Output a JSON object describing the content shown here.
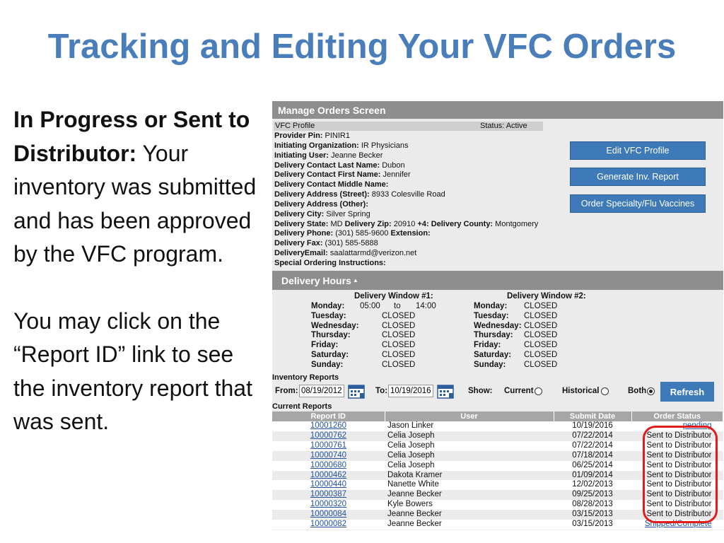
{
  "slide": {
    "title": "Tracking and Editing Your VFC Orders",
    "para1_bold": "In Progress or Sent to Distributor:",
    "para1_rest": " Your inventory was submitted and has been approved by the VFC program.",
    "para2": "You may click on the “Report ID” link to see the inventory report that was sent.",
    "highlight_color": "#e41b1b"
  },
  "screen": {
    "title": "Manage Orders Screen",
    "profile_label": "VFC Profile",
    "status_label": "Status: Active",
    "fields": [
      {
        "label": "Provider Pin:",
        "value": " PINIR1"
      },
      {
        "label": "Initiating Organization:",
        "value": " IR Physicians"
      },
      {
        "label": "Initiating User:",
        "value": " Jeanne Becker"
      },
      {
        "label": "Delivery Contact Last Name:",
        "value": " Dubon"
      },
      {
        "label": "Delivery Contact First Name:",
        "value": " Jennifer"
      },
      {
        "label": "Delivery Contact Middle Name:",
        "value": ""
      },
      {
        "label": "Delivery Address (Street):",
        "value": " 8933 Colesville Road"
      },
      {
        "label": "Delivery Address (Other):",
        "value": ""
      },
      {
        "label": "Delivery City:",
        "value": " Silver Spring"
      },
      {
        "label": "Delivery State:",
        "value": " MD ",
        "label2": "Delivery Zip:",
        "value2": " 20910 ",
        "label3": "+4:",
        "value3": " ",
        "label4": "Delivery County:",
        "value4": " Montgomery"
      },
      {
        "label": "Delivery Phone:",
        "value": " (301) 585-9600 ",
        "label2": "Extension:",
        "value2": ""
      },
      {
        "label": "Delivery Fax:",
        "value": " (301) 585-5888"
      },
      {
        "label": "DeliveryEmail:",
        "value": " saalattarmd@verizon.net"
      },
      {
        "label": "Special Ordering Instructions:",
        "value": ""
      }
    ],
    "buttons": {
      "edit_profile": "Edit VFC Profile",
      "generate_report": "Generate Inv. Report",
      "order_specialty": "Order Specialty/Flu Vaccines"
    },
    "delivery_hours": {
      "title": "Delivery Hours",
      "window1_title": "Delivery Window #1:",
      "window2_title": "Delivery Window #2:",
      "days": [
        "Monday:",
        "Tuesday:",
        "Wednesday:",
        "Thursday:",
        "Friday:",
        "Saturday:",
        "Sunday:"
      ],
      "monday_from": "05:00",
      "monday_to_word": "to",
      "monday_to": "14:00",
      "window1_closed": [
        "CLOSED",
        "CLOSED",
        "CLOSED",
        "CLOSED",
        "CLOSED",
        "CLOSED"
      ],
      "window2": [
        "CLOSED",
        "CLOSED",
        "CLOSED",
        "CLOSED",
        "CLOSED",
        "CLOSED",
        "CLOSED"
      ]
    },
    "inventory": {
      "label": "Inventory Reports",
      "from_label": "From:",
      "from_value": "08/19/2012",
      "to_label": "To:",
      "to_value": "10/19/2016",
      "show_label": "Show:",
      "current_label": "Current",
      "historical_label": "Historical",
      "both_label": "Both",
      "selected": "Both",
      "refresh_label": "Refresh"
    },
    "current_reports_label": "Current Reports",
    "table": {
      "headers": [
        "Report ID",
        "User",
        "Submit Date",
        "Order Status"
      ],
      "rows": [
        {
          "id": "10001260",
          "user": "Jason Linker",
          "date": "10/19/2016",
          "status": "pending",
          "status_link": true
        },
        {
          "id": "10000762",
          "user": "Celia Joseph",
          "date": "07/22/2014",
          "status": "Sent to Distributor",
          "status_link": false
        },
        {
          "id": "10000761",
          "user": "Celia Joseph",
          "date": "07/22/2014",
          "status": "Sent to Distributor",
          "status_link": false
        },
        {
          "id": "10000740",
          "user": "Celia Joseph",
          "date": "07/18/2014",
          "status": "Sent to Distributor",
          "status_link": false
        },
        {
          "id": "10000680",
          "user": "Celia Joseph",
          "date": "06/25/2014",
          "status": "Sent to Distributor",
          "status_link": false
        },
        {
          "id": "10000462",
          "user": "Dakota Kramer",
          "date": "01/09/2014",
          "status": "Sent to Distributor",
          "status_link": false
        },
        {
          "id": "10000440",
          "user": "Nanette White",
          "date": "12/02/2013",
          "status": "Sent to Distributor",
          "status_link": false
        },
        {
          "id": "10000387",
          "user": "Jeanne Becker",
          "date": "09/25/2013",
          "status": "Sent to Distributor",
          "status_link": false
        },
        {
          "id": "10000320",
          "user": "Kyle Bowers",
          "date": "08/28/2013",
          "status": "Sent to Distributor",
          "status_link": false
        },
        {
          "id": "10000084",
          "user": "Jeanne Becker",
          "date": "03/15/2013",
          "status": "Sent to Distributor",
          "status_link": false
        },
        {
          "id": "10000082",
          "user": "Jeanne Becker",
          "date": "03/15/2013",
          "status": "Shipped/Complete",
          "status_link": true
        }
      ]
    }
  }
}
